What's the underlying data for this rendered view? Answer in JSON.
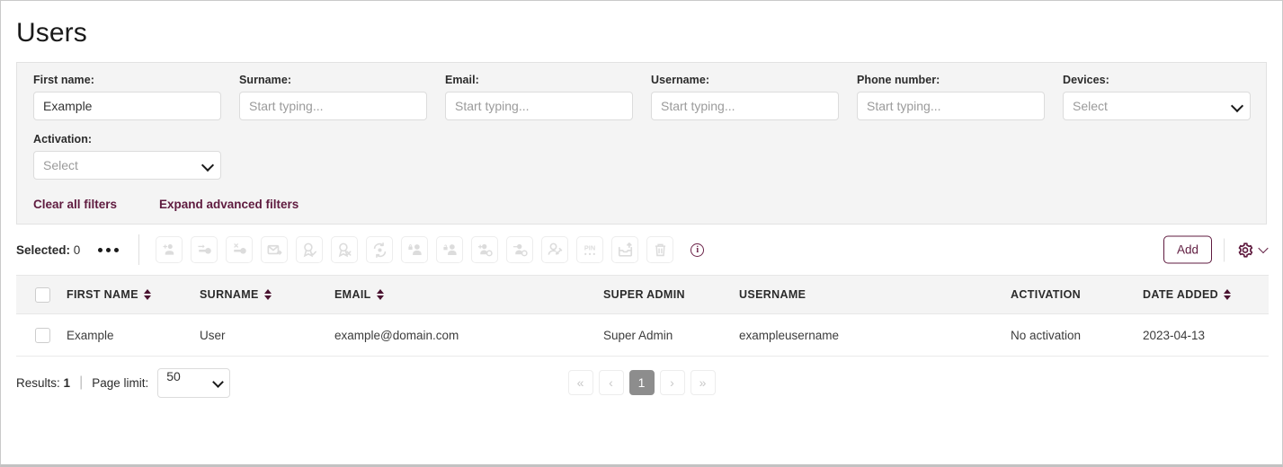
{
  "page": {
    "title": "Users"
  },
  "filters": {
    "fields": [
      {
        "label": "First name:",
        "type": "text",
        "value": "Example",
        "placeholder": "Start typing...",
        "name": "first-name"
      },
      {
        "label": "Surname:",
        "type": "text",
        "value": "",
        "placeholder": "Start typing...",
        "name": "surname"
      },
      {
        "label": "Email:",
        "type": "text",
        "value": "",
        "placeholder": "Start typing...",
        "name": "email"
      },
      {
        "label": "Username:",
        "type": "text",
        "value": "",
        "placeholder": "Start typing...",
        "name": "username"
      },
      {
        "label": "Phone number:",
        "type": "text",
        "value": "",
        "placeholder": "Start typing...",
        "name": "phone-number"
      },
      {
        "label": "Devices:",
        "type": "select",
        "value": "Select",
        "placeholder": "Select",
        "name": "devices"
      },
      {
        "label": "Activation:",
        "type": "select",
        "value": "Select",
        "placeholder": "Select",
        "name": "activation"
      }
    ],
    "clear_all_label": "Clear all filters",
    "expand_label": "Expand advanced filters",
    "link_color": "#5f1b3f"
  },
  "toolbar": {
    "selected_label": "Selected:",
    "selected_count": "0",
    "overflow_icon": "ellipsis-icon",
    "add_label": "Add",
    "settings_icon": "gear-icon",
    "info_icon": "info-circle-icon",
    "info_glyph": "i",
    "accent_color": "#5f1b3f",
    "actions": [
      {
        "name": "add-users-icon",
        "title": "Add users"
      },
      {
        "name": "grant-key-icon",
        "title": "Grant key"
      },
      {
        "name": "revoke-key-icon",
        "title": "Revoke key"
      },
      {
        "name": "send-email-icon",
        "title": "Send email"
      },
      {
        "name": "approve-badge-icon",
        "title": "Approve"
      },
      {
        "name": "reject-badge-icon",
        "title": "Reject"
      },
      {
        "name": "sync-refresh-icon",
        "title": "Sync"
      },
      {
        "name": "lock-user-icon",
        "title": "Lock user"
      },
      {
        "name": "unlock-user-icon",
        "title": "Unlock user"
      },
      {
        "name": "add-user-settings-icon",
        "title": "Add user settings"
      },
      {
        "name": "remove-user-settings-icon",
        "title": "Remove user settings"
      },
      {
        "name": "edit-user-icon",
        "title": "Edit user"
      },
      {
        "name": "pin-icon",
        "title": "PIN"
      },
      {
        "name": "export-icon",
        "title": "Export"
      },
      {
        "name": "delete-icon",
        "title": "Delete"
      }
    ]
  },
  "table": {
    "select_all_name": "select-all-checkbox",
    "columns": [
      {
        "label": "FIRST NAME",
        "sortable": true,
        "key": "first_name"
      },
      {
        "label": "SURNAME",
        "sortable": true,
        "key": "surname"
      },
      {
        "label": "EMAIL",
        "sortable": true,
        "key": "email"
      },
      {
        "label": "SUPER ADMIN",
        "sortable": false,
        "key": "super_admin"
      },
      {
        "label": "USERNAME",
        "sortable": false,
        "key": "username"
      },
      {
        "label": "ACTIVATION",
        "sortable": false,
        "key": "activation"
      },
      {
        "label": "DATE ADDED",
        "sortable": true,
        "key": "date_added"
      }
    ],
    "rows": [
      {
        "first_name": "Example",
        "surname": "User",
        "email": "example@domain.com",
        "super_admin": "Super Admin",
        "username": "exampleusername",
        "activation": "No activation",
        "date_added": "2023-04-13"
      }
    ]
  },
  "footer": {
    "results_label": "Results:",
    "results_count": "1",
    "separator": "|",
    "page_limit_label": "Page limit:",
    "page_limit_value": "50",
    "pagination": {
      "first": "«",
      "prev": "‹",
      "current": "1",
      "next": "›",
      "last": "»"
    }
  }
}
